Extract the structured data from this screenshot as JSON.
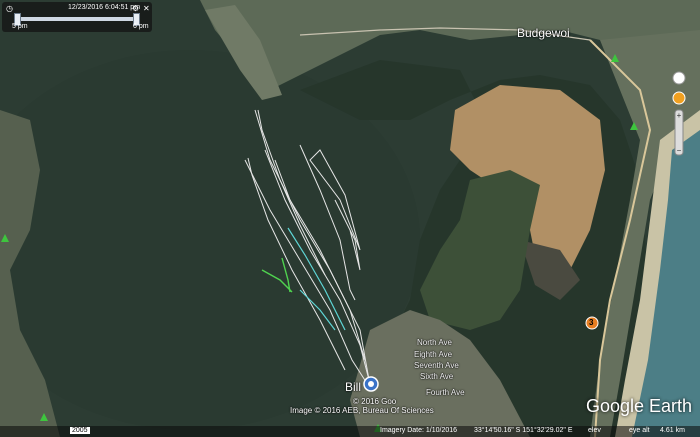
{
  "time_slider": {
    "date_label": "12/23/2016",
    "time_label": "6:04:51 pm",
    "start_label": "5 pm",
    "end_label": "6 pm",
    "icons": [
      "clock-icon",
      "settings-wrench-icon",
      "close-icon"
    ]
  },
  "place_labels": {
    "budgewoi": "Budgewoi",
    "billy": "Bill"
  },
  "street_labels": {
    "north_ave": "North Ave",
    "eighth_ave": "Eighth Ave",
    "seventh_ave": "Seventh Ave",
    "sixth_ave": "Sixth Ave",
    "fourth_ave": "Fourth Ave"
  },
  "attribution": {
    "copyright": "© 2016 Goo",
    "image_credit": "Image © 2016 AEB, Bureau Of Sciences"
  },
  "status_bar": {
    "road_badge": "2005",
    "imagery_date": "Imagery Date: 1/10/2016",
    "coordinates": "33°14'50.16\" S  151°32'29.02\" E",
    "elev_label": "elev",
    "eye_alt": "eye alt",
    "eye_alt_value": "4.61 km"
  },
  "branding": {
    "logo": "Google Earth"
  },
  "road_shield": "3",
  "colors": {
    "lake": "#2c3d34",
    "forest": "#27372c",
    "lagoon": "#b69263",
    "track_main": "#e6e6e6",
    "track_teal": "#5fd6d6",
    "track_green": "#4fd34f"
  }
}
